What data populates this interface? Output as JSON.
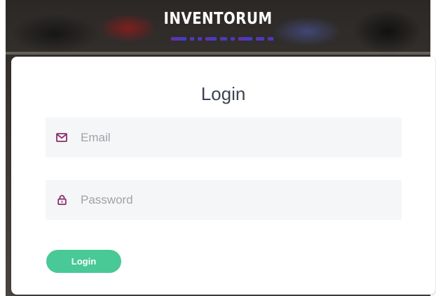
{
  "brand": {
    "name": "INVENTORUM"
  },
  "login_form": {
    "title": "Login",
    "email": {
      "placeholder": "Email",
      "value": "",
      "icon": "mail-icon"
    },
    "password": {
      "placeholder": "Password",
      "value": "",
      "icon": "lock-icon"
    },
    "submit_label": "Login"
  },
  "colors": {
    "accent": "#48c995",
    "icon": "#8a2c6a",
    "field_background": "#f5f6f7",
    "title_text": "#3d4554"
  }
}
